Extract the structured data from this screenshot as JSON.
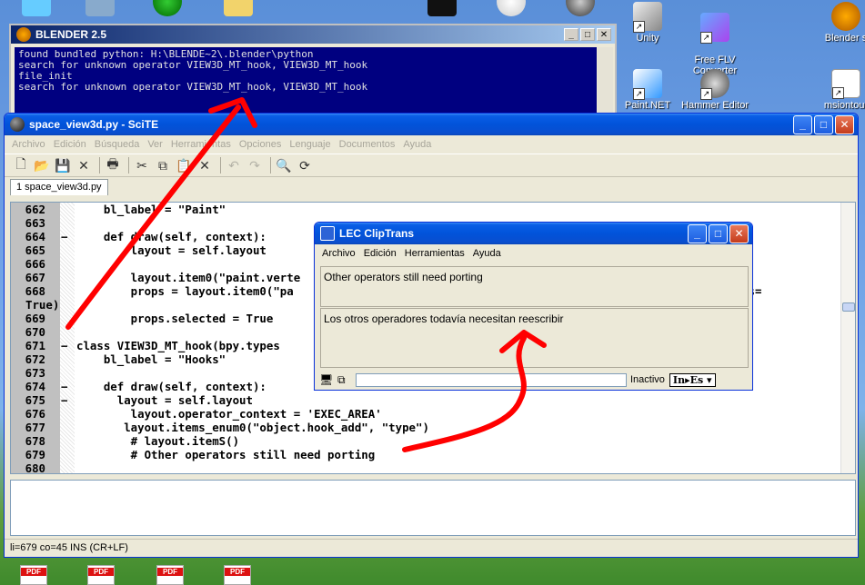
{
  "desktop": {
    "icons": [
      {
        "label": "Unity"
      },
      {
        "label": "Free FLV\nConverter"
      },
      {
        "label": "Blender s"
      },
      {
        "label": "Paint.NET"
      },
      {
        "label": "Hammer Editor"
      },
      {
        "label": "msiontour"
      }
    ],
    "pdf_label": "PDF"
  },
  "blender": {
    "title": "BLENDER 2.5",
    "lines": [
      "found bundled python: H:\\BLENDE~2\\.blender\\python",
      "search for unknown operator VIEW3D_MT_hook, VIEW3D_MT_hook",
      "file_init",
      "search for unknown operator VIEW3D_MT_hook, VIEW3D_MT_hook"
    ]
  },
  "scite": {
    "title": "space_view3d.py - SciTE",
    "menu": [
      "Archivo",
      "Edición",
      "Búsqueda",
      "Ver",
      "Herramientas",
      "Opciones",
      "Lenguaje",
      "Documentos",
      "Ayuda"
    ],
    "tab": "1 space_view3d.py",
    "status": "li=679 co=45 INS (CR+LF)",
    "code": [
      {
        "n": "662",
        "f": "",
        "t": "    bl_label = \"Paint\""
      },
      {
        "n": "663",
        "f": "",
        "t": ""
      },
      {
        "n": "664",
        "f": "−",
        "t": "    def draw(self, context):"
      },
      {
        "n": "665",
        "f": "",
        "t": "        layout = self.layout"
      },
      {
        "n": "666",
        "f": "",
        "t": ""
      },
      {
        "n": "667",
        "f": "",
        "t": "        layout.item0(\"paint.verte"
      },
      {
        "n": "668",
        "f": "",
        "t": "        props = layout.item0(\"pa                                                            operties="
      },
      {
        "n": "",
        "f": "",
        "t": "True)"
      },
      {
        "n": "669",
        "f": "",
        "t": "        props.selected = True"
      },
      {
        "n": "670",
        "f": "",
        "t": ""
      },
      {
        "n": "671",
        "f": "−",
        "t": "class VIEW3D_MT_hook(bpy.types"
      },
      {
        "n": "672",
        "f": "",
        "t": "    bl_label = \"Hooks\""
      },
      {
        "n": "673",
        "f": "",
        "t": ""
      },
      {
        "n": "674",
        "f": "−",
        "t": "    def draw(self, context):"
      },
      {
        "n": "675",
        "f": "−",
        "t": "      layout = self.layout"
      },
      {
        "n": "676",
        "f": "",
        "t": "        layout.operator_context = 'EXEC_AREA'"
      },
      {
        "n": "677",
        "f": "",
        "t": "       layout.items_enum0(\"object.hook_add\", \"type\")"
      },
      {
        "n": "678",
        "f": "",
        "t": "        # layout.itemS()"
      },
      {
        "n": "679",
        "f": "",
        "t": "        # Other operators still need porting"
      },
      {
        "n": "680",
        "f": "",
        "t": ""
      }
    ]
  },
  "cliptrans": {
    "title": "LEC ClipTrans",
    "menu": [
      "Archivo",
      "Edición",
      "Herramientas",
      "Ayuda"
    ],
    "source_text": "Other operators still need porting",
    "target_text": "Los otros operadores todavía necesitan reescribir",
    "status": "Inactivo",
    "lang": "In▸Es ▾"
  },
  "colors": {
    "title_blue": "#0153da",
    "console_bg": "#000080",
    "annotation_red": "#ff0000"
  }
}
